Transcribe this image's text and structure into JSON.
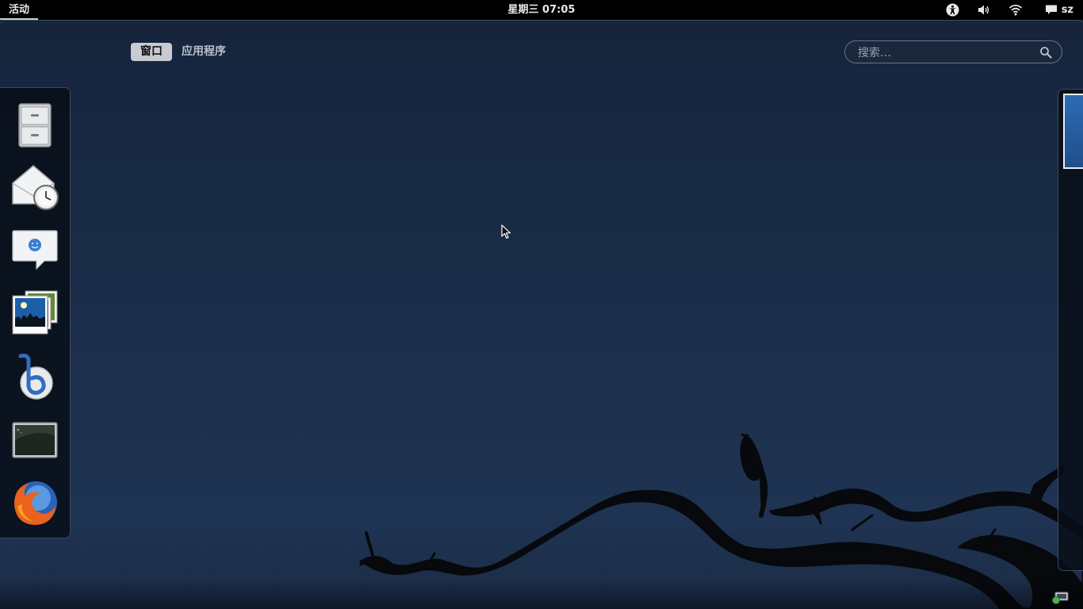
{
  "top_panel": {
    "activities_label": "活动",
    "clock": "星期三 07:05",
    "user_name": "sz",
    "status_icons": [
      "accessibility-icon",
      "volume-icon",
      "wifi-icon",
      "chat-icon"
    ]
  },
  "overview": {
    "tabs": [
      {
        "label": "窗口",
        "active": true
      },
      {
        "label": "应用程序",
        "active": false
      }
    ],
    "search": {
      "placeholder": "搜索…",
      "value": ""
    }
  },
  "dash": {
    "items": [
      "file-cabinet-icon",
      "mail-clock-icon",
      "chat-bubble-icon",
      "photo-viewer-icon",
      "music-player-icon",
      "terminal-icon",
      "firefox-icon"
    ]
  },
  "colors": {
    "panel_bg": "#000000",
    "wallpaper_top": "#15243b",
    "wallpaper_bottom": "#1f3453",
    "active_tab_bg": "#c8ccd2",
    "workspace_thumb": "#2c6cb4"
  }
}
